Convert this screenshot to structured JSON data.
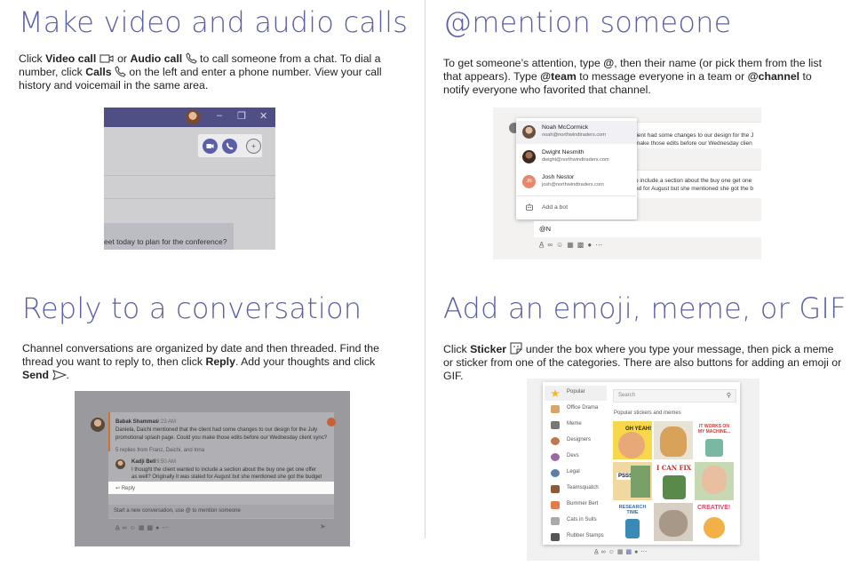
{
  "sections": {
    "calls": {
      "title": "Make video and audio calls",
      "p1": "Click ",
      "b1": "Video call",
      "p2": " or ",
      "b2": "Audio call",
      "p3": " to call someone from a chat. To dial a number, click ",
      "b3": "Calls",
      "p4": " on the left and enter a phone number. View your call history and voicemail in the same area.",
      "screenshot_text": "eet today to plan for the conference?"
    },
    "mention": {
      "title": "@mention someone",
      "p1": "To get someone’s attention, type ",
      "b1": "@",
      "p2": ", then their name (or pick them from the list that appears). Type ",
      "b2": "@team",
      "p3": " to message everyone in a team or ",
      "b3": "@channel",
      "p4": " to notify everyone who favorited that channel.",
      "people": [
        {
          "name": "Noah McCormick",
          "email": "noah@northwindtraders.com"
        },
        {
          "name": "Dwight Nesmith",
          "email": "dwight@northwindtraders.com"
        },
        {
          "name": "Josh Nestor",
          "email": "josh@northwindtraders.com",
          "initials": "JN"
        }
      ],
      "add_bot": "Add a bot",
      "composer_text": "@N",
      "behind": [
        "lient had some changes to our design for the J",
        "make those edits before our Wednesday clien",
        "o include a section about the buy one get one",
        "ed for August but she mentioned she got the b"
      ]
    },
    "reply": {
      "title": "Reply to a conversation",
      "p1": "Channel conversations are organized by date and then threaded. Find the thread you want to reply to, then click ",
      "b1": "Reply",
      "p2": ". Add your thoughts and click ",
      "b2": "Send",
      "p3": ".",
      "author1": "Babak Shammas",
      "time1": "9:23 AM",
      "msg1_line1": "Daniela, Daichi mentioned that the client had some changes to our design for the July",
      "msg1_line2": "promotional splash page. Could you make those edits before our Wednesday client sync?",
      "replies_from": "5 replies from Franz, Daichi, and Inna",
      "author2": "Kadji Bell",
      "time2": "9:50 AM",
      "msg2_line1": "I thought the client wanted to include a section about the buy one get one offer",
      "msg2_line2": "as well? Originally it was slated for August but she mentioned she got the budget",
      "reply_label": "Reply",
      "new_conversation": "Start a new conversation, use @ to mention someone"
    },
    "emoji": {
      "title": "Add an emoji, meme, or GIF",
      "p1": "Click ",
      "b1": "Sticker",
      "p2": " under the box where you type your message, then pick a meme or sticker from one of the categories. There are also buttons for adding an emoji or GIF.",
      "search_placeholder": "Search",
      "popular_label": "Popular stickers and memes",
      "categories": [
        "Popular",
        "Office Drama",
        "Meme",
        "Designers",
        "Devs",
        "Legal",
        "Teamsquatch",
        "Bummer Bert",
        "Cats in Suits",
        "Rubber Stamps"
      ],
      "sticker_texts": [
        "OH YEAH!",
        "IT WORKS ON MY MACHINE...",
        "PSSST!",
        "I CAN FIX IT",
        "RESEARCH TIME",
        "CREATIVE!"
      ]
    }
  },
  "colors": {
    "heading": "#5b5fa7",
    "accent": "#5b5fa7"
  }
}
